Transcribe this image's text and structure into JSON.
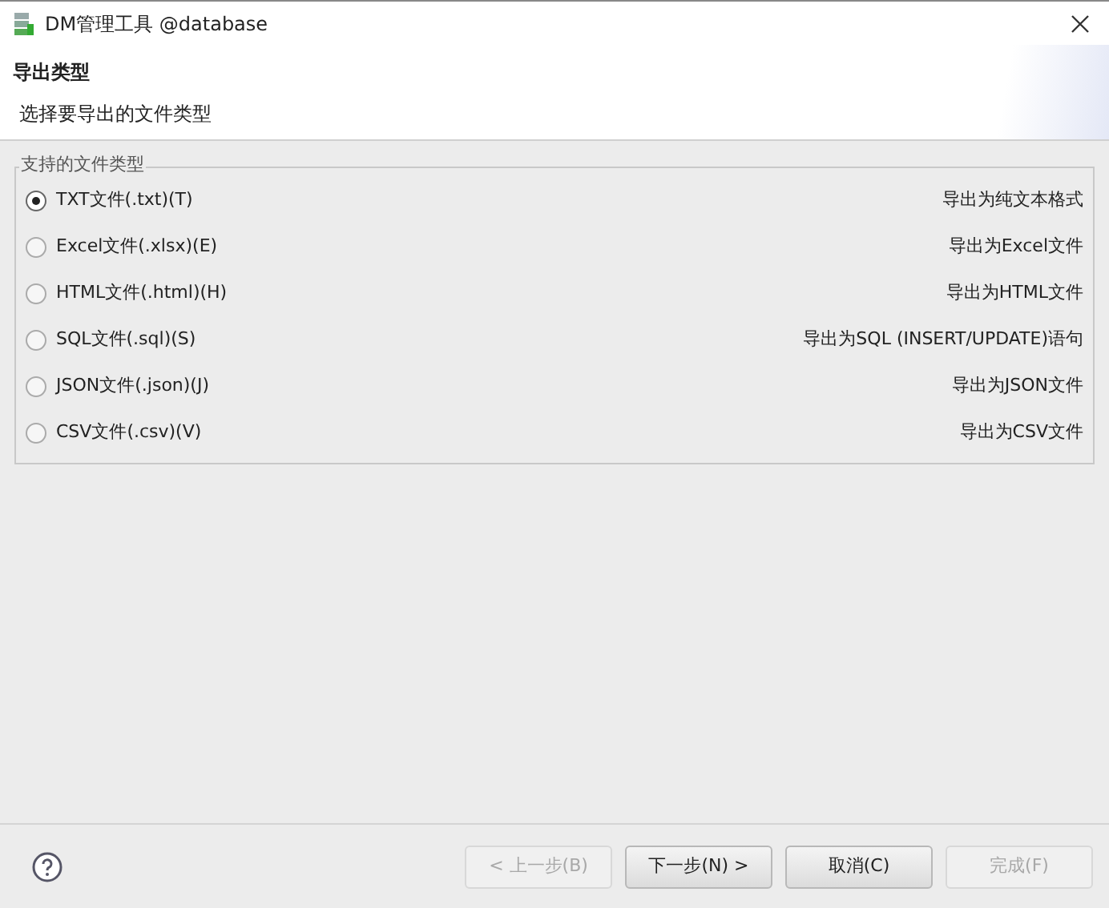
{
  "window": {
    "title": "DM管理工具 @database"
  },
  "header": {
    "title": "导出类型",
    "subtitle": "选择要导出的文件类型"
  },
  "group": {
    "legend": "支持的文件类型",
    "options": [
      {
        "label": "TXT文件(.txt)(T)",
        "description": "导出为纯文本格式",
        "selected": true
      },
      {
        "label": "Excel文件(.xlsx)(E)",
        "description": "导出为Excel文件",
        "selected": false
      },
      {
        "label": "HTML文件(.html)(H)",
        "description": "导出为HTML文件",
        "selected": false
      },
      {
        "label": "SQL文件(.sql)(S)",
        "description": "导出为SQL (INSERT/UPDATE)语句",
        "selected": false
      },
      {
        "label": "JSON文件(.json)(J)",
        "description": "导出为JSON文件",
        "selected": false
      },
      {
        "label": "CSV文件(.csv)(V)",
        "description": "导出为CSV文件",
        "selected": false
      }
    ]
  },
  "buttons": [
    {
      "label": "< 上一步(B)",
      "disabled": true
    },
    {
      "label": "下一步(N) >",
      "disabled": false
    },
    {
      "label": "取消(C)",
      "disabled": false
    },
    {
      "label": "完成(F)",
      "disabled": true
    }
  ]
}
